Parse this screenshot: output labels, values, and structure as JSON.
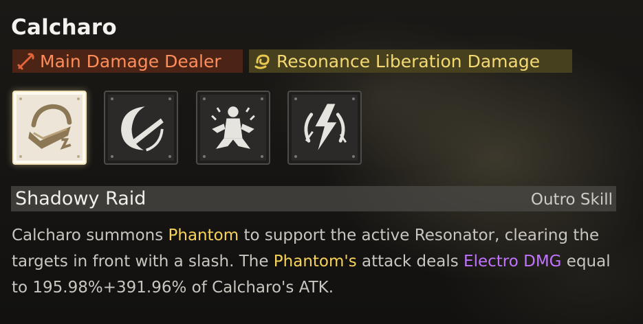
{
  "character": {
    "name": "Calcharo"
  },
  "tags": [
    {
      "label": "Main Damage Dealer",
      "icon": "sword-icon",
      "color": "#ff8d5a"
    },
    {
      "label": "Resonance Liberation Damage",
      "icon": "swirl-icon",
      "color": "#f3d973"
    }
  ],
  "skill_icons": [
    {
      "name": "shadowy-raid-skill-icon",
      "selected": true
    },
    {
      "name": "slash-skill-icon",
      "selected": false
    },
    {
      "name": "figure-skill-icon",
      "selected": false
    },
    {
      "name": "lightning-skill-icon",
      "selected": false
    }
  ],
  "skill": {
    "name": "Shadowy Raid",
    "type": "Outro Skill",
    "description": {
      "p1": "Calcharo summons ",
      "h1": "Phantom",
      "p2": " to support the active Resonator, clearing the targets in front with a slash. The ",
      "h2": "Phantom's",
      "p3": " attack deals ",
      "h3": "Electro DMG",
      "p4": " equal to 195.98%+391.96% of Calcharo's ATK."
    }
  },
  "colors": {
    "highlight_gold": "#f7d35a",
    "highlight_purple": "#c173ff",
    "text": "#c9c6c0"
  }
}
